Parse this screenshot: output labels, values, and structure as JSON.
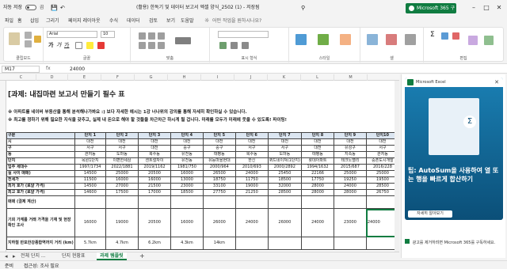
{
  "titlebar": {
    "autosave": "자동 저장",
    "toggle": "끔",
    "file_title": "(활용) 한독기 및 데이터 보고서 엑셀 양식_2502 (1) - 저장됨",
    "search_placeholder": "검색",
    "ms365": "Microsoft 365 구입"
  },
  "tabs": [
    "파일",
    "홈",
    "삽입",
    "그리기",
    "페이지 레이아웃",
    "수식",
    "데이터",
    "검토",
    "보기",
    "도움말",
    "어떤 작업을 원하시나요?"
  ],
  "ribbon": {
    "font_name": "Arial",
    "font_size": "10",
    "groups": [
      "클립보드",
      "글꼴",
      "맞춤",
      "표시 형식",
      "스타일",
      "셀",
      "편집"
    ]
  },
  "formula_bar": {
    "name_box": "M17",
    "fx": "fx",
    "content": "24000"
  },
  "columns": [
    "C",
    "D",
    "E",
    "F",
    "G",
    "H",
    "I",
    "J",
    "K",
    "L",
    "M"
  ],
  "sheet": {
    "title": "[과제: 내집마련 보고서 만들기 필수 표",
    "intro1": "※ 아파트를 네이버 부동산을 통해 분석해나가봐요 :) 보다 자세한 예시는 1강 너나위의 강의를 통해 자세히 확인하실 수 있습니다.",
    "intro2": "※ 최고를 정하기 위해 필요한 지식을 갖추고, 실제 내 돈으로 해야 할 것들을 차근차근 하시게 될 겁니다. 미래를 모두가 미래에 웃을 수 있도록! 파이팅!"
  },
  "table": {
    "header": [
      "구분",
      "단지 1",
      "단지 2",
      "단지 3",
      "단지 4",
      "단지 5",
      "단지 6",
      "단지 7",
      "단지 8",
      "단지 9",
      "단지10"
    ],
    "rows": [
      [
        "시",
        "대전",
        "대전",
        "대전",
        "대전",
        "대전",
        "대전",
        "대전",
        "대전",
        "대전",
        "대전"
      ],
      [
        "구",
        "서구",
        "서구",
        "대전",
        "중구",
        "중구",
        "서구",
        "서구",
        "대전",
        "유성구",
        "서구"
      ],
      [
        "동",
        "관저동",
        "도마동",
        "복수동",
        "유천동",
        "태평동",
        "복수동",
        "도마동",
        "태평동",
        "지족동",
        "관저동"
      ],
      [
        "단지",
        "목원1단지",
        "이편한세상",
        "센트럴자이",
        "유천동",
        "유등마을현대",
        "한신",
        "퀴드네이쳐(1단지)",
        "롯데아파트",
        "테크노밸리",
        "중촌도시개발"
      ],
      [
        "입주 세대수",
        "1997/1734",
        "2022/1881",
        "2019/1162",
        "1981/750",
        "2000/964",
        "2010/693",
        "2000/2892",
        "1994/1632",
        "2015/687",
        "2016/228"
      ],
      [
        "실 사이 매매)",
        "14500",
        "25000",
        "20500",
        "16000",
        "26500",
        "24000",
        "25450",
        "22166",
        "25000",
        "25000"
      ],
      [
        "전세가",
        "11500",
        "16000",
        "16000",
        "13000",
        "18750",
        "11750",
        "18500",
        "17750",
        "19250",
        "19500"
      ],
      [
        "최저 호가 (로얄 가격)",
        "14500",
        "27000",
        "21500",
        "23000",
        "33100",
        "19000",
        "32000",
        "28000",
        "24000",
        "28500"
      ],
      [
        "최고 호가 (로얄 가격)",
        "14600",
        "17500",
        "17000",
        "18500",
        "27750",
        "21250",
        "28500",
        "28000",
        "28000",
        "26750"
      ],
      [
        "매매 (결제 계산)",
        "",
        "",
        "",
        "",
        "",
        "",
        "",
        "",
        "",
        ""
      ]
    ],
    "tall_row": [
      "기회 가계를 거래 가격을 기재 및 현장 확인 조사",
      "16000",
      "19000",
      "20500",
      "16000",
      "26000",
      "24000",
      "26000",
      "24000",
      "23000",
      "24000"
    ],
    "last_row": [
      "지하철 반포한강종합역까지 거리 (km)",
      "5.7km",
      "4.7km",
      "6.2km",
      "4.3km",
      "14km",
      "",
      "",
      "",
      "",
      ""
    ]
  },
  "sheet_tabs": [
    "전체 단지 ...",
    "단지 현황표",
    "과제 템플릿",
    "+"
  ],
  "status": {
    "ready": "준비",
    "accessibility": "접근성: 조사 필요"
  },
  "pane": {
    "app": "Microsoft Excel",
    "promo": "팁: AutoSum을 사용하여 열 또는 행을 빠르게 합산하기",
    "button": "자세히 알아보기",
    "footer": "광고를 제거하려면 Microsoft 365를 구독하세요."
  }
}
